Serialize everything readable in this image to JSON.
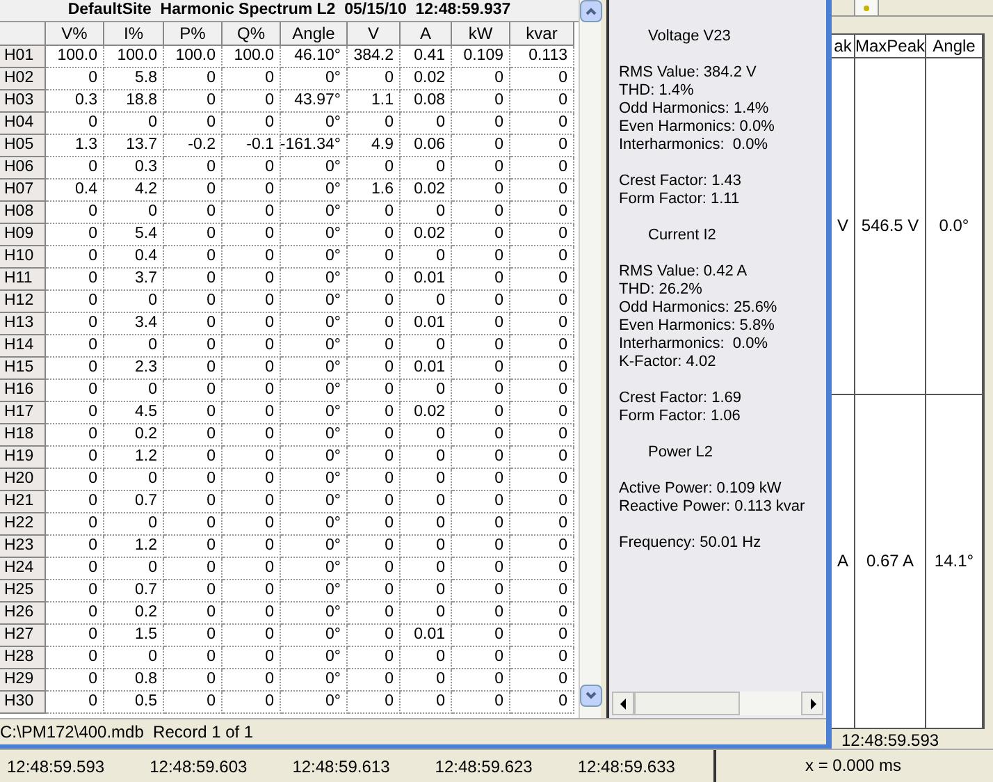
{
  "spectrum_window": {
    "title": "DefaultSite  Harmonic Spectrum L2  05/15/10  12:48:59.937",
    "columns": [
      "V%",
      "I%",
      "P%",
      "Q%",
      "Angle",
      "V",
      "A",
      "kW",
      "kvar"
    ],
    "rows": [
      {
        "label": "H01",
        "cells": [
          "100.0",
          "100.0",
          "100.0",
          "100.0",
          "46.10°",
          "384.2",
          "0.41",
          "0.109",
          "0.113"
        ]
      },
      {
        "label": "H02",
        "cells": [
          "0",
          "5.8",
          "0",
          "0",
          "0°",
          "0",
          "0.02",
          "0",
          "0"
        ]
      },
      {
        "label": "H03",
        "cells": [
          "0.3",
          "18.8",
          "0",
          "0",
          "43.97°",
          "1.1",
          "0.08",
          "0",
          "0"
        ]
      },
      {
        "label": "H04",
        "cells": [
          "0",
          "0",
          "0",
          "0",
          "0°",
          "0",
          "0",
          "0",
          "0"
        ]
      },
      {
        "label": "H05",
        "cells": [
          "1.3",
          "13.7",
          "-0.2",
          "-0.1",
          "-161.34°",
          "4.9",
          "0.06",
          "0",
          "0"
        ]
      },
      {
        "label": "H06",
        "cells": [
          "0",
          "0.3",
          "0",
          "0",
          "0°",
          "0",
          "0",
          "0",
          "0"
        ]
      },
      {
        "label": "H07",
        "cells": [
          "0.4",
          "4.2",
          "0",
          "0",
          "0°",
          "1.6",
          "0.02",
          "0",
          "0"
        ]
      },
      {
        "label": "H08",
        "cells": [
          "0",
          "0",
          "0",
          "0",
          "0°",
          "0",
          "0",
          "0",
          "0"
        ]
      },
      {
        "label": "H09",
        "cells": [
          "0",
          "5.4",
          "0",
          "0",
          "0°",
          "0",
          "0.02",
          "0",
          "0"
        ]
      },
      {
        "label": "H10",
        "cells": [
          "0",
          "0.4",
          "0",
          "0",
          "0°",
          "0",
          "0",
          "0",
          "0"
        ]
      },
      {
        "label": "H11",
        "cells": [
          "0",
          "3.7",
          "0",
          "0",
          "0°",
          "0",
          "0.01",
          "0",
          "0"
        ]
      },
      {
        "label": "H12",
        "cells": [
          "0",
          "0",
          "0",
          "0",
          "0°",
          "0",
          "0",
          "0",
          "0"
        ]
      },
      {
        "label": "H13",
        "cells": [
          "0",
          "3.4",
          "0",
          "0",
          "0°",
          "0",
          "0.01",
          "0",
          "0"
        ]
      },
      {
        "label": "H14",
        "cells": [
          "0",
          "0",
          "0",
          "0",
          "0°",
          "0",
          "0",
          "0",
          "0"
        ]
      },
      {
        "label": "H15",
        "cells": [
          "0",
          "2.3",
          "0",
          "0",
          "0°",
          "0",
          "0.01",
          "0",
          "0"
        ]
      },
      {
        "label": "H16",
        "cells": [
          "0",
          "0",
          "0",
          "0",
          "0°",
          "0",
          "0",
          "0",
          "0"
        ]
      },
      {
        "label": "H17",
        "cells": [
          "0",
          "4.5",
          "0",
          "0",
          "0°",
          "0",
          "0.02",
          "0",
          "0"
        ]
      },
      {
        "label": "H18",
        "cells": [
          "0",
          "0.2",
          "0",
          "0",
          "0°",
          "0",
          "0",
          "0",
          "0"
        ]
      },
      {
        "label": "H19",
        "cells": [
          "0",
          "1.2",
          "0",
          "0",
          "0°",
          "0",
          "0",
          "0",
          "0"
        ]
      },
      {
        "label": "H20",
        "cells": [
          "0",
          "0",
          "0",
          "0",
          "0°",
          "0",
          "0",
          "0",
          "0"
        ]
      },
      {
        "label": "H21",
        "cells": [
          "0",
          "0.7",
          "0",
          "0",
          "0°",
          "0",
          "0",
          "0",
          "0"
        ]
      },
      {
        "label": "H22",
        "cells": [
          "0",
          "0",
          "0",
          "0",
          "0°",
          "0",
          "0",
          "0",
          "0"
        ]
      },
      {
        "label": "H23",
        "cells": [
          "0",
          "1.2",
          "0",
          "0",
          "0°",
          "0",
          "0",
          "0",
          "0"
        ]
      },
      {
        "label": "H24",
        "cells": [
          "0",
          "0",
          "0",
          "0",
          "0°",
          "0",
          "0",
          "0",
          "0"
        ]
      },
      {
        "label": "H25",
        "cells": [
          "0",
          "0.7",
          "0",
          "0",
          "0°",
          "0",
          "0",
          "0",
          "0"
        ]
      },
      {
        "label": "H26",
        "cells": [
          "0",
          "0.2",
          "0",
          "0",
          "0°",
          "0",
          "0",
          "0",
          "0"
        ]
      },
      {
        "label": "H27",
        "cells": [
          "0",
          "1.5",
          "0",
          "0",
          "0°",
          "0",
          "0.01",
          "0",
          "0"
        ]
      },
      {
        "label": "H28",
        "cells": [
          "0",
          "0",
          "0",
          "0",
          "0°",
          "0",
          "0",
          "0",
          "0"
        ]
      },
      {
        "label": "H29",
        "cells": [
          "0",
          "0.8",
          "0",
          "0",
          "0°",
          "0",
          "0",
          "0",
          "0"
        ]
      },
      {
        "label": "H30",
        "cells": [
          "0",
          "0.5",
          "0",
          "0",
          "0°",
          "0",
          "0",
          "0",
          "0"
        ]
      }
    ],
    "status": "C:\\PM172\\400.mdb  Record 1 of 1"
  },
  "summary_panel": {
    "sections": [
      {
        "heading": "Voltage V23",
        "groups": [
          [
            "RMS Value: 384.2 V",
            "THD: 1.4%",
            "Odd Harmonics: 1.4%",
            "Even Harmonics: 0.0%",
            "Interharmonics:  0.0%"
          ],
          [
            "Crest Factor: 1.43",
            "Form Factor: 1.11"
          ]
        ]
      },
      {
        "heading": "Current I2",
        "groups": [
          [
            "RMS Value: 0.42 A",
            "THD: 26.2%",
            "Odd Harmonics: 25.6%",
            "Even Harmonics: 5.8%",
            "Interharmonics:  0.0%",
            "K-Factor: 4.02"
          ],
          [
            "Crest Factor: 1.69",
            "Form Factor: 1.06"
          ]
        ]
      },
      {
        "heading": "Power L2",
        "groups": [
          [
            "Active Power: 0.109 kW",
            "Reactive Power: 0.113 kvar"
          ],
          [
            "Frequency: 50.01 Hz"
          ]
        ]
      }
    ]
  },
  "background_table": {
    "columns": [
      "ak",
      "MaxPeak",
      "Angle"
    ],
    "rows": [
      [
        "V",
        "546.5 V",
        "0.0°"
      ],
      [
        "A",
        "0.67 A",
        "14.1°"
      ]
    ],
    "marker_time": "12:48:59.593",
    "cursor_offset": "x = 0.000 ms"
  },
  "time_axis": [
    "12:48:59.593",
    "12:48:59.603",
    "12:48:59.613",
    "12:48:59.623",
    "12:48:59.633"
  ]
}
